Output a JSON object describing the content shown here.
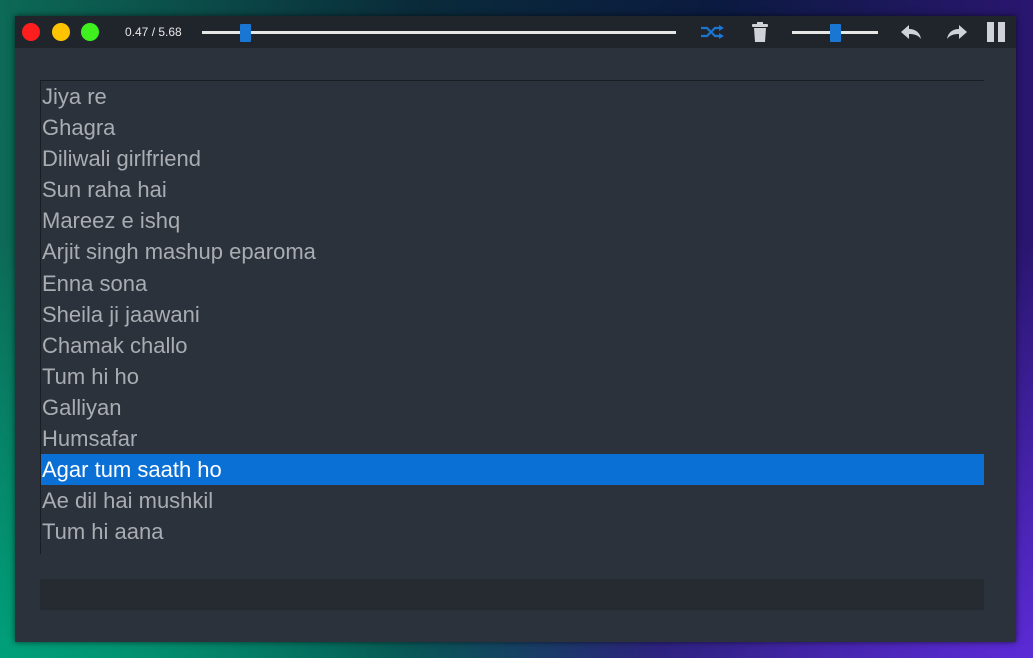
{
  "titlebar": {
    "time_display": "0.47 / 5.68",
    "seek_progress": 0.083,
    "volume_level": 0.45
  },
  "colors": {
    "accent": "#1976d2",
    "selected_row": "#0a70d6",
    "window_bg": "#2c323b",
    "close": "#ff1e1e",
    "minimize": "#ffc400",
    "maximize": "#3ef01e"
  },
  "icons": {
    "shuffle": "shuffle-icon",
    "delete": "trash-icon",
    "previous": "back-arrow-icon",
    "next": "forward-arrow-icon",
    "pause": "pause-icon"
  },
  "playlist": {
    "selected_index": 12,
    "songs": [
      "Jiya re",
      "Ghagra",
      "Diliwali girlfriend",
      "Sun raha hai",
      "Mareez e ishq",
      "Arjit singh mashup eparoma",
      "Enna sona",
      "Sheila ji jaawani",
      "Chamak challo",
      "Tum hi ho",
      "Galliyan",
      "Humsafar",
      "Agar tum saath ho",
      "Ae dil hai mushkil",
      "Tum hi aana"
    ]
  },
  "status_bar": {
    "text": ""
  }
}
